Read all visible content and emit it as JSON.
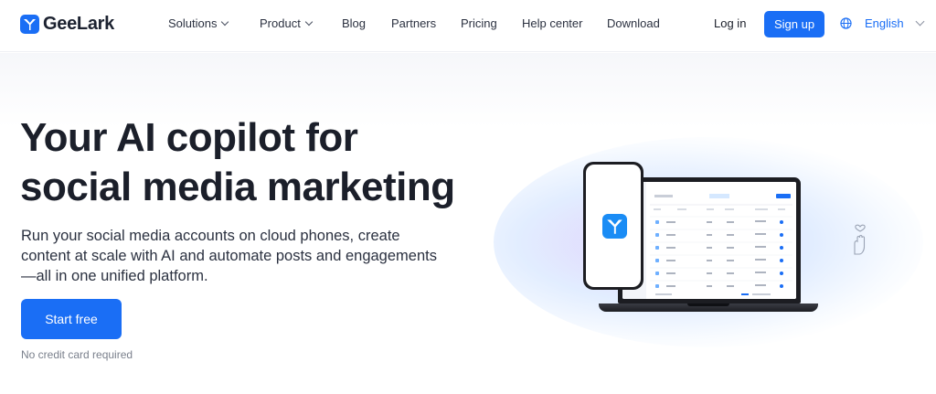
{
  "brand": {
    "name": "GeeLark",
    "accent": "#1a6ef5"
  },
  "nav": {
    "items": [
      {
        "label": "Solutions",
        "has_dropdown": true
      },
      {
        "label": "Product",
        "has_dropdown": true
      },
      {
        "label": "Blog",
        "has_dropdown": false
      },
      {
        "label": "Partners",
        "has_dropdown": false
      },
      {
        "label": "Pricing",
        "has_dropdown": false
      },
      {
        "label": "Help center",
        "has_dropdown": false
      },
      {
        "label": "Download",
        "has_dropdown": false
      }
    ],
    "login_label": "Log in",
    "signup_label": "Sign up",
    "language_label": "English"
  },
  "hero": {
    "headline_line1": "Your AI copilot for",
    "headline_line2": "social media marketing",
    "subtext": "Run your social media accounts on cloud phones, create content at scale with AI and automate posts and engagements—all in one unified platform.",
    "cta_label": "Start free",
    "note": "No credit card required"
  },
  "icons": [
    "geelark-logo-icon",
    "chevron-down-icon",
    "globe-icon",
    "phone-app-icon",
    "hand-heart-icon"
  ]
}
